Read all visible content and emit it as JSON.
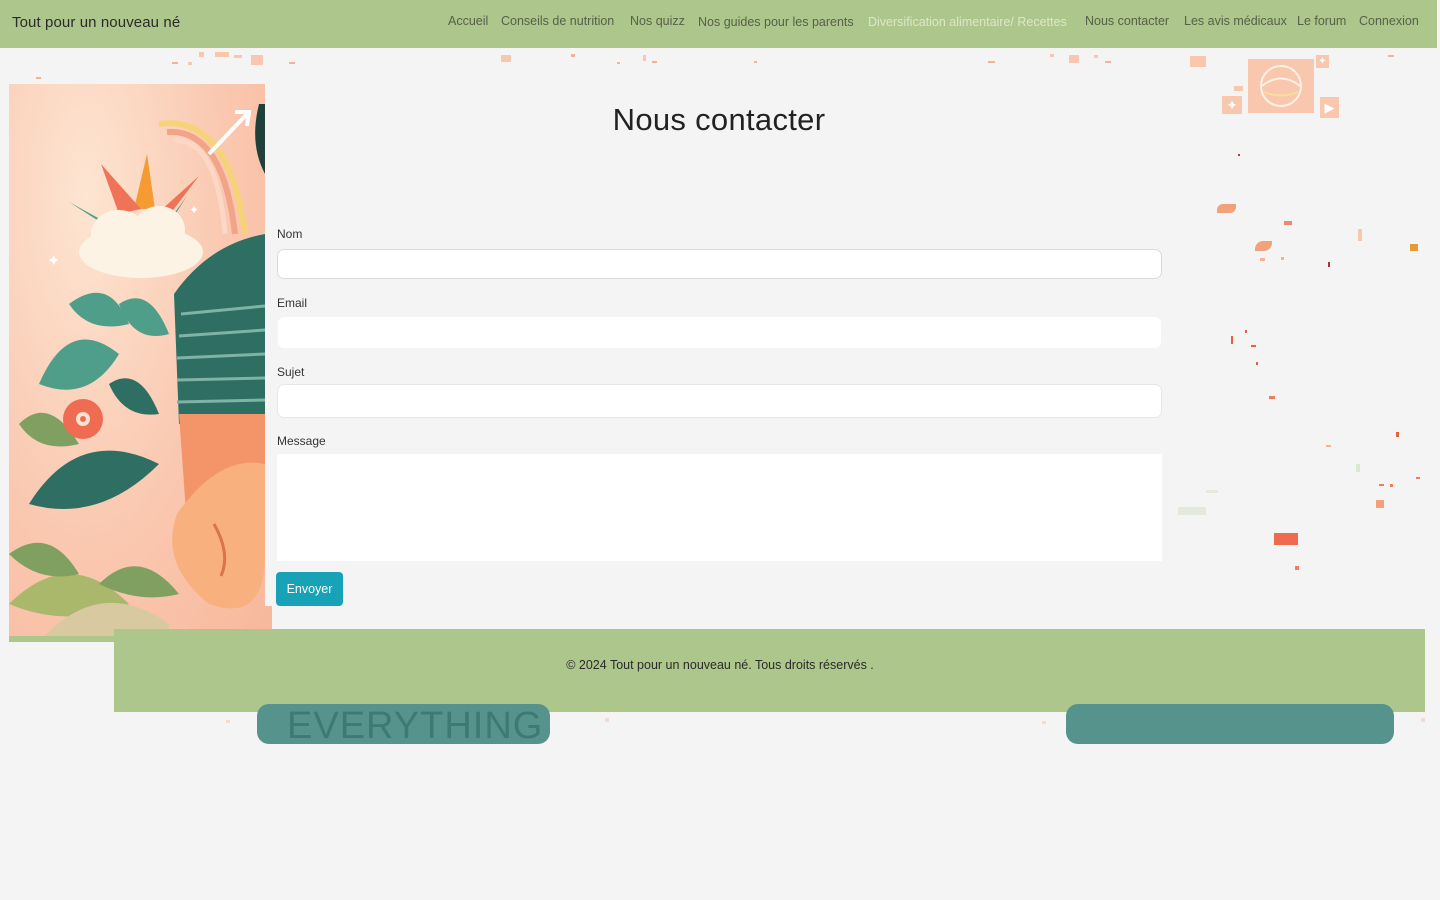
{
  "navbar": {
    "brand": "Tout pour un nouveau né",
    "links": [
      {
        "label": "Accueil"
      },
      {
        "label": "Conseils de nutrition"
      },
      {
        "label": "Nos quizz"
      },
      {
        "label": "Nos guides pour les parents"
      },
      {
        "label": "Diversification alimentaire/ Recettes"
      },
      {
        "label": "Nous contacter"
      },
      {
        "label": "Les avis médicaux"
      },
      {
        "label": "Le forum"
      },
      {
        "label": "Connexion"
      }
    ]
  },
  "contact": {
    "title": "Nous contacter",
    "fields": {
      "name_label": "Nom",
      "email_label": "Email",
      "subject_label": "Sujet",
      "message_label": "Message"
    },
    "submit_label": "Envoyer"
  },
  "footer": {
    "copyright": "© 2024 Tout pour un nouveau né. Tous droits réservés ."
  },
  "banner": {
    "left_text": "EVERYTHING"
  },
  "colors": {
    "navbar_bg": "#adc68b",
    "footer_bg": "#adc68b",
    "submit_bg": "#17a2b8",
    "pill_bg": "#55938c",
    "page_bg": "#f4f4f4"
  }
}
